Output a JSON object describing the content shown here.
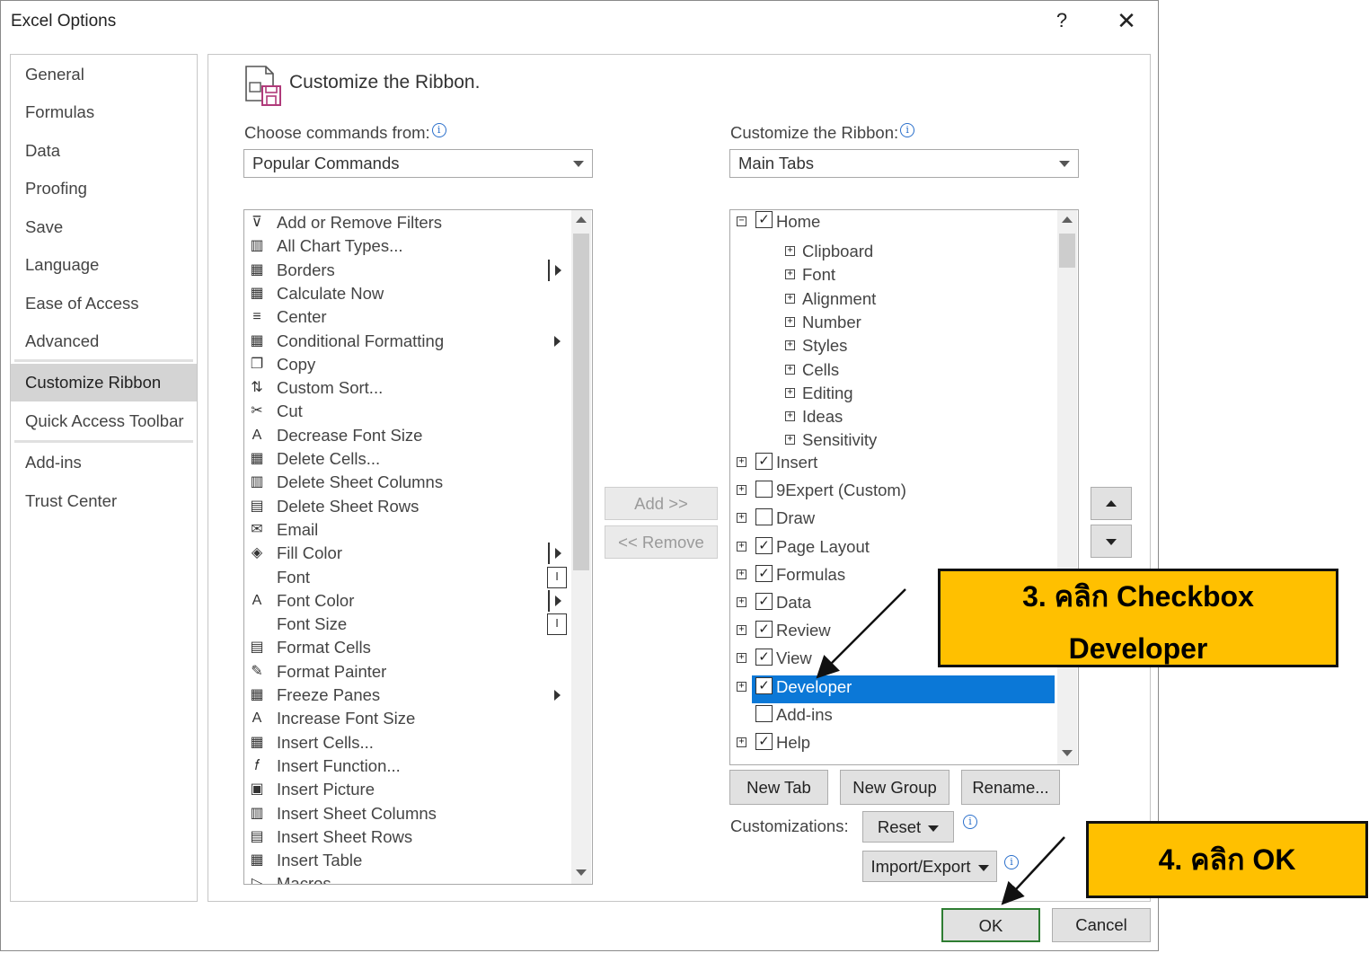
{
  "dialog": {
    "title": "Excel Options",
    "help": "?",
    "close": "✕"
  },
  "nav": {
    "items": [
      "General",
      "Formulas",
      "Data",
      "Proofing",
      "Save",
      "Language",
      "Ease of Access",
      "Advanced",
      "Customize Ribbon",
      "Quick Access Toolbar",
      "Add-ins",
      "Trust Center"
    ],
    "selected": "Customize Ribbon"
  },
  "header": {
    "title": "Customize the Ribbon."
  },
  "left": {
    "label": "Choose commands from:",
    "combo_value": "Popular Commands",
    "commands": [
      "Add or Remove Filters",
      "All Chart Types...",
      "Borders",
      "Calculate Now",
      "Center",
      "Conditional Formatting",
      "Copy",
      "Custom Sort...",
      "Cut",
      "Decrease Font Size",
      "Delete Cells...",
      "Delete Sheet Columns",
      "Delete Sheet Rows",
      "Email",
      "Fill Color",
      "Font",
      "Font Color",
      "Font Size",
      "Format Cells",
      "Format Painter",
      "Freeze Panes",
      "Increase Font Size",
      "Insert Cells...",
      "Insert Function...",
      "Insert Picture",
      "Insert Sheet Columns",
      "Insert Sheet Rows",
      "Insert Table",
      "Macros"
    ]
  },
  "middle": {
    "add": "Add >>",
    "remove": "<< Remove"
  },
  "right": {
    "label": "Customize the Ribbon:",
    "combo_value": "Main Tabs",
    "home": "Home",
    "home_groups": [
      "Clipboard",
      "Font",
      "Alignment",
      "Number",
      "Styles",
      "Cells",
      "Editing",
      "Ideas",
      "Sensitivity"
    ],
    "tabs": [
      "Insert",
      "9Expert (Custom)",
      "Draw",
      "Page Layout",
      "Formulas",
      "Data",
      "Review",
      "View",
      "Developer",
      "Add-ins",
      "Help"
    ],
    "tabs_checked": [
      true,
      false,
      false,
      true,
      true,
      true,
      true,
      true,
      true,
      false,
      true
    ],
    "selected_tab": "Developer",
    "new_tab": "New Tab",
    "new_group": "New Group",
    "rename": "Rename...",
    "customizations_label": "Customizations:",
    "reset": "Reset",
    "import_export": "Import/Export"
  },
  "footer": {
    "ok": "OK",
    "cancel": "Cancel"
  },
  "callouts": {
    "step3_line1": "3. คลิก Checkbox",
    "step3_line2": "Developer",
    "step4": "4. คลิก OK"
  },
  "colors": {
    "selection": "#0b78d7",
    "callout": "#ffc000",
    "ok_border": "#2e7d32"
  }
}
